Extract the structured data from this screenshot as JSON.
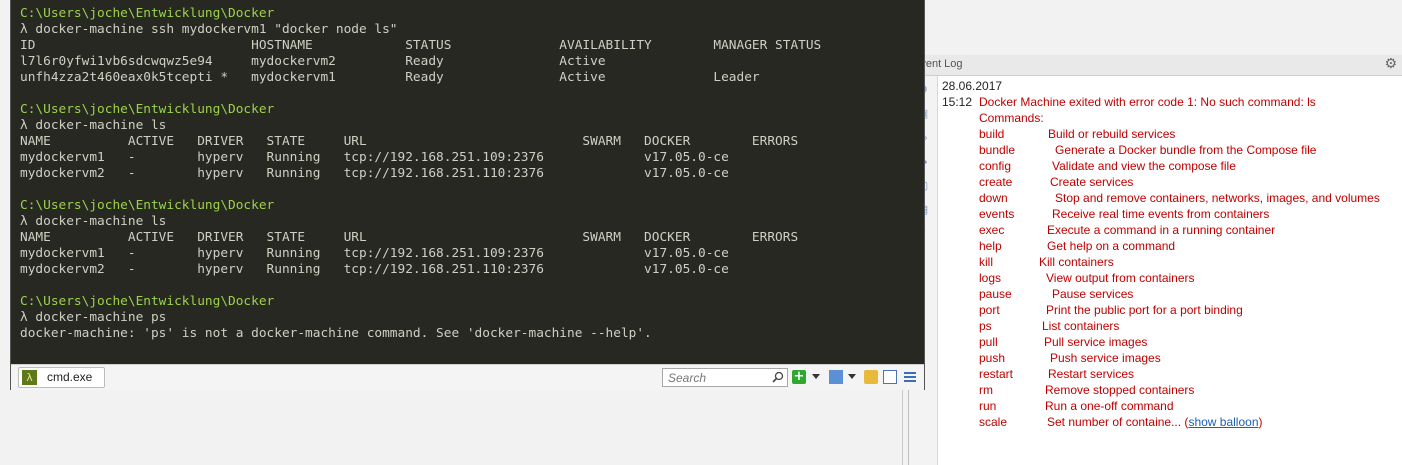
{
  "event_log": {
    "title": "Event Log",
    "date": "28.06.2017",
    "time": "15:12",
    "message": "Docker Machine exited with error code 1: No such command: ls",
    "commands_header": "Commands:",
    "commands": [
      {
        "name": "build",
        "desc": "Build or rebuild services"
      },
      {
        "name": "bundle",
        "desc": "Generate a Docker bundle from the Compose file"
      },
      {
        "name": "config",
        "desc": "Validate and view the compose file"
      },
      {
        "name": "create",
        "desc": "Create services"
      },
      {
        "name": "down",
        "desc": "Stop and remove containers, networks, images, and volumes"
      },
      {
        "name": "events",
        "desc": "Receive real time events from containers"
      },
      {
        "name": "exec",
        "desc": "Execute a command in a running container"
      },
      {
        "name": "help",
        "desc": "Get help on a command"
      },
      {
        "name": "kill",
        "desc": "Kill containers"
      },
      {
        "name": "logs",
        "desc": "View output from containers"
      },
      {
        "name": "pause",
        "desc": "Pause services"
      },
      {
        "name": "port",
        "desc": "Print the public port for a port binding"
      },
      {
        "name": "ps",
        "desc": "List containers"
      },
      {
        "name": "pull",
        "desc": "Pull service images"
      },
      {
        "name": "push",
        "desc": "Push service images"
      },
      {
        "name": "restart",
        "desc": "Restart services"
      },
      {
        "name": "rm",
        "desc": "Remove stopped containers"
      },
      {
        "name": "run",
        "desc": "Run a one-off command"
      },
      {
        "name": "scale",
        "desc": "Set number of containe..."
      }
    ],
    "show_balloon_label": "show balloon"
  },
  "terminal": {
    "lines": [
      {
        "type": "path",
        "text": "C:\\Users\\joche\\Entwicklung\\Docker"
      },
      {
        "type": "cmd",
        "text": "λ docker-machine ssh mydockervm1 \"docker node ls\""
      },
      {
        "type": "out",
        "text": "ID                            HOSTNAME            STATUS              AVAILABILITY        MANAGER STATUS"
      },
      {
        "type": "out",
        "text": "l7l6r0yfwi1vb6sdcwqwz5e94     mydockervm2         Ready               Active"
      },
      {
        "type": "out",
        "text": "unfh4zza2t460eax0k5tcepti *   mydockervm1         Ready               Active              Leader"
      },
      {
        "type": "out",
        "text": ""
      },
      {
        "type": "path",
        "text": "C:\\Users\\joche\\Entwicklung\\Docker"
      },
      {
        "type": "cmd",
        "text": "λ docker-machine ls"
      },
      {
        "type": "out",
        "text": "NAME          ACTIVE   DRIVER   STATE     URL                            SWARM   DOCKER        ERRORS"
      },
      {
        "type": "out",
        "text": "mydockervm1   -        hyperv   Running   tcp://192.168.251.109:2376             v17.05.0-ce"
      },
      {
        "type": "out",
        "text": "mydockervm2   -        hyperv   Running   tcp://192.168.251.110:2376             v17.05.0-ce"
      },
      {
        "type": "out",
        "text": ""
      },
      {
        "type": "path",
        "text": "C:\\Users\\joche\\Entwicklung\\Docker"
      },
      {
        "type": "cmd",
        "text": "λ docker-machine ls"
      },
      {
        "type": "out",
        "text": "NAME          ACTIVE   DRIVER   STATE     URL                            SWARM   DOCKER        ERRORS"
      },
      {
        "type": "out",
        "text": "mydockervm1   -        hyperv   Running   tcp://192.168.251.109:2376             v17.05.0-ce"
      },
      {
        "type": "out",
        "text": "mydockervm2   -        hyperv   Running   tcp://192.168.251.110:2376             v17.05.0-ce"
      },
      {
        "type": "out",
        "text": ""
      },
      {
        "type": "path",
        "text": "C:\\Users\\joche\\Entwicklung\\Docker"
      },
      {
        "type": "cmd",
        "text": "λ docker-machine ps"
      },
      {
        "type": "out",
        "text": "docker-machine: 'ps' is not a docker-machine command. See 'docker-machine --help'."
      }
    ]
  },
  "tabbar": {
    "tab_label": "cmd.exe",
    "tab_icon": "λ",
    "search_placeholder": "Search",
    "add_icon": "+"
  },
  "colors": {
    "terminal_bg": "#272822",
    "prompt_path": "#9bd24a",
    "log_error": "#c00000"
  }
}
